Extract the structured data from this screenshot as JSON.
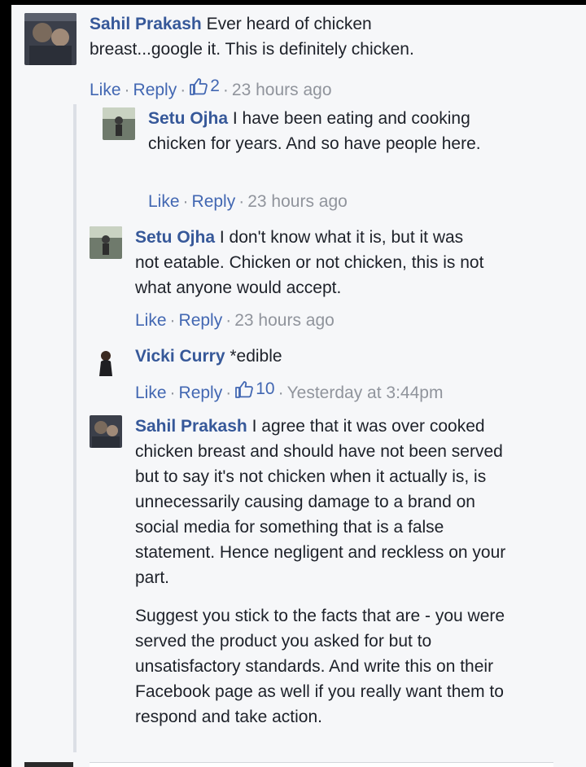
{
  "comments": [
    {
      "author": "Sahil Prakash",
      "text": "Ever heard of chicken breast...google it. This is definitely chicken.",
      "actions": {
        "like": "Like",
        "reply": "Reply"
      },
      "likes": "2",
      "time": "23 hours ago",
      "icon": "thumbs-up-icon"
    }
  ],
  "replies": [
    {
      "author": "Setu Ojha",
      "text": "I have been eating and cooking chicken for years. And so have people here.",
      "actions": {
        "like": "Like",
        "reply": "Reply"
      },
      "time": "23 hours ago"
    },
    {
      "author": "Setu Ojha",
      "text": "I don't know what it is, but it was not eatable. Chicken or not chicken, this is not what anyone would accept.",
      "actions": {
        "like": "Like",
        "reply": "Reply"
      },
      "time": "23 hours ago"
    },
    {
      "author": "Vicki Curry",
      "text": "*edible",
      "actions": {
        "like": "Like",
        "reply": "Reply"
      },
      "likes": "10",
      "time": "Yesterday at 3:44pm",
      "icon": "thumbs-up-icon"
    },
    {
      "author": "Sahil Prakash",
      "text": "I agree that it was over cooked chicken breast and should have not been served but to say it's not chicken when it actually is, is unnecessarily causing damage to a brand on social media for something that is a false statement. Hence negligent and reckless on your part.",
      "text2": "Suggest you stick to the facts that are - you were served the product you asked for but to unsatisfactory standards. And write this on their Facebook page as well if you really want them to respond and take action."
    }
  ],
  "colors": {
    "author": "#365899",
    "link": "#4267b2",
    "meta": "#90949c",
    "background": "#f6f7f9"
  }
}
